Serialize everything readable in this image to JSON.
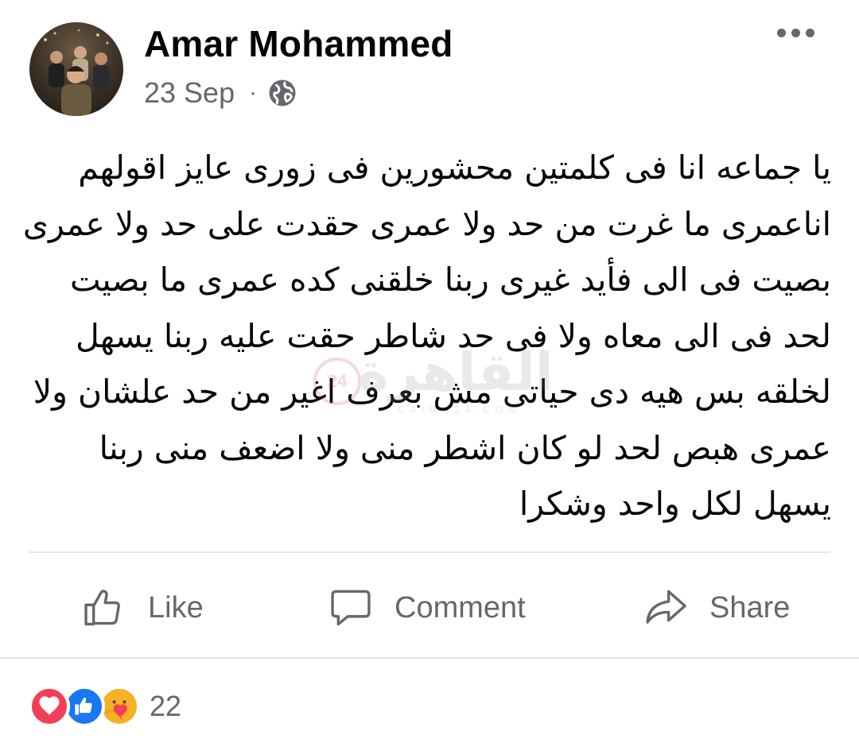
{
  "post": {
    "author": "Amar Mohammed",
    "date": "23 Sep",
    "separator": "·",
    "privacy_icon": "globe-icon",
    "more_icon": "more-horizontal-icon",
    "body_lines": [
      "يا جماعه انا فى كلمتين محشورين فى زورى عايز اقولهم",
      "اناعمرى ما غرت من حد ولا عمرى حقدت على حد ولا عمرى",
      "بصيت فى الى فأيد غيرى  ربنا خلقنى كده عمرى ما بصيت",
      "لحد فى الى معاه ولا فى حد شاطر حقت عليه ربنا يسهل",
      "لخلقه بس هيه دى حياتى مش بعرف اغير من حد علشان ولا",
      "عمرى هبص لحد لو كان اشطر منى ولا اضعف منى ربنا",
      "يسهل لكل واحد وشكرا"
    ],
    "watermark": {
      "text": "القاهرة",
      "badge": "24",
      "subtext": "CAIRO24.COM"
    }
  },
  "actions": {
    "like_label": "Like",
    "comment_label": "Comment",
    "share_label": "Share"
  },
  "reactions": {
    "types": [
      "love-icon",
      "like-icon",
      "care-icon"
    ],
    "count": "22"
  },
  "colors": {
    "text_primary": "#050505",
    "text_secondary": "#65676b",
    "divider": "#e4e6eb",
    "like_blue": "#1877f2",
    "love_red": "#f33e58",
    "care_yellow": "#f7b125"
  }
}
